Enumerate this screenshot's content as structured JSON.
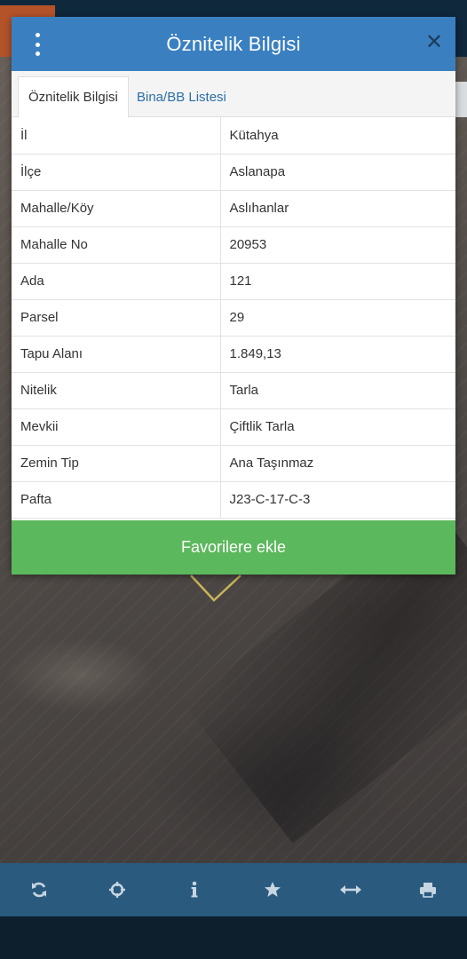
{
  "dialog": {
    "title": "Öznitelik Bilgisi",
    "menu_icon": "vertical-dots-icon",
    "close_icon": "close-icon",
    "tabs": [
      {
        "label": "Öznitelik Bilgisi",
        "active": true
      },
      {
        "label": "Bina/BB Listesi",
        "active": false
      }
    ],
    "rows": [
      {
        "key": "İl",
        "value": "Kütahya"
      },
      {
        "key": "İlçe",
        "value": "Aslanapa"
      },
      {
        "key": "Mahalle/Köy",
        "value": "Aslıhanlar"
      },
      {
        "key": "Mahalle No",
        "value": "20953"
      },
      {
        "key": "Ada",
        "value": "121"
      },
      {
        "key": "Parsel",
        "value": "29"
      },
      {
        "key": "Tapu Alanı",
        "value": "1.849,13"
      },
      {
        "key": "Nitelik",
        "value": "Tarla"
      },
      {
        "key": "Mevkii",
        "value": "Çiftlik Tarla"
      },
      {
        "key": "Zemin Tip",
        "value": "Ana Taşınmaz"
      },
      {
        "key": "Pafta",
        "value": "J23-C-17-C-3"
      }
    ],
    "favorite_button": "Favorilere ekle"
  },
  "toolbar": {
    "icons": [
      "refresh-icon",
      "crosshair-icon",
      "info-icon",
      "star-icon",
      "horizontal-arrows-icon",
      "print-icon"
    ]
  },
  "colors": {
    "header": "#3a80c1",
    "favorite": "#5cb85c",
    "toolbar": "#2a5a7e",
    "tab_link": "#2d6fa8",
    "toolbar_icon": "#c8d6e2"
  }
}
